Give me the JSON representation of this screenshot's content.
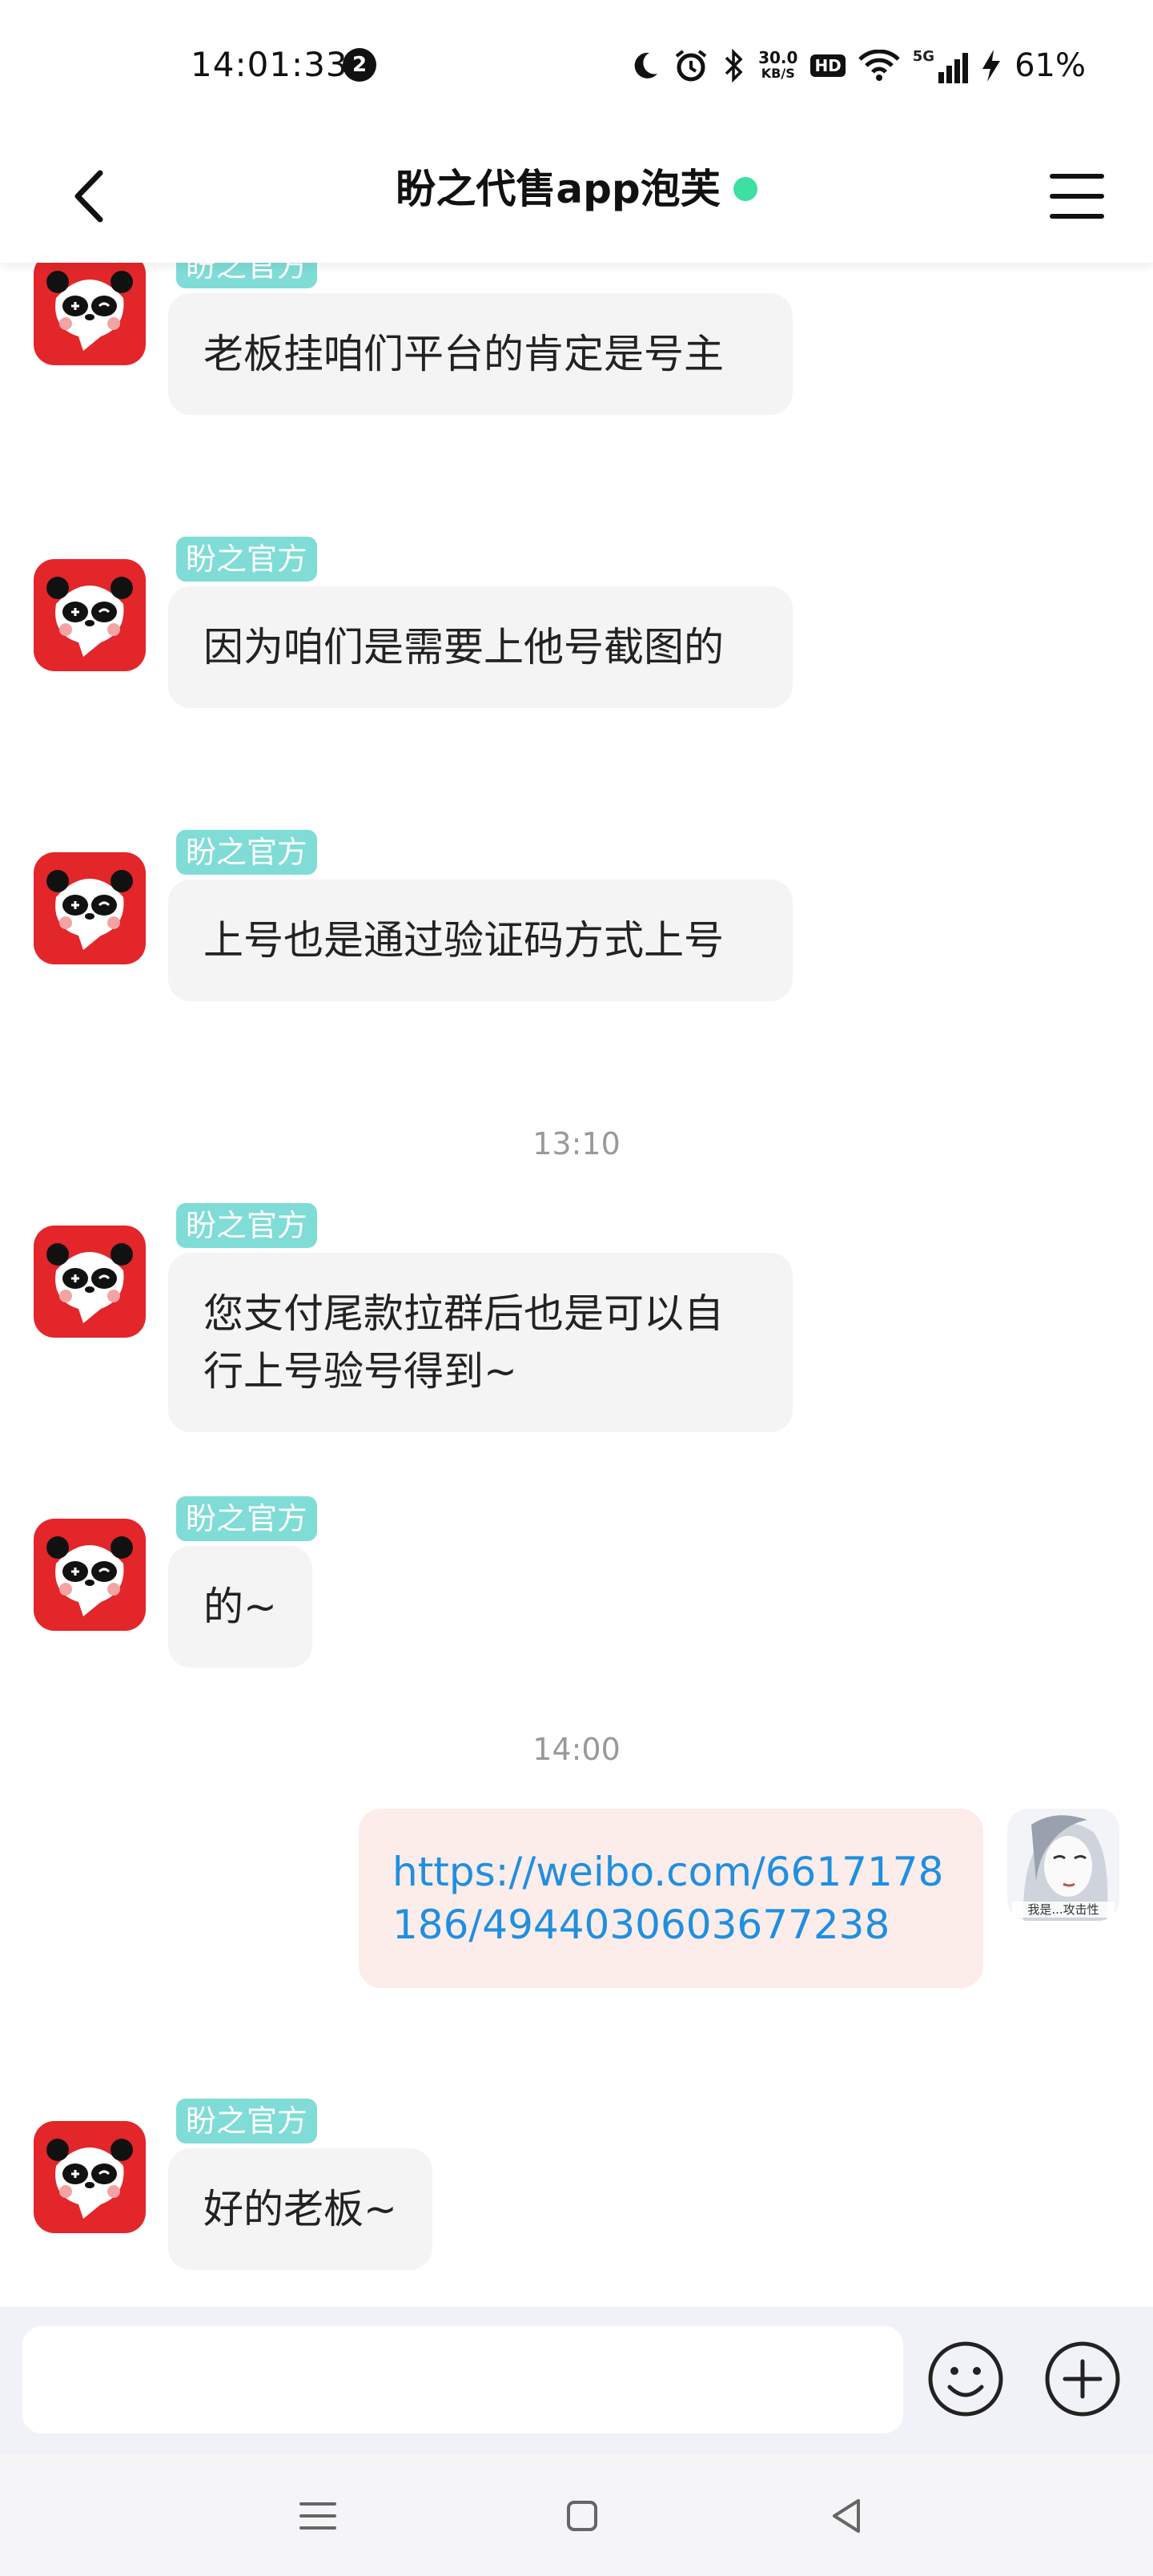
{
  "status_bar": {
    "time": "14:01:33",
    "notification_count": "2",
    "net_speed_value": "30.0",
    "net_speed_unit": "KB/S",
    "hd_label": "HD",
    "network_label": "5G",
    "battery": "61%"
  },
  "header": {
    "title": "盼之代售app泡芙"
  },
  "messages": [
    {
      "sender": "盼之官方",
      "text": "老板挂咱们平台的肯定是号主"
    },
    {
      "sender": "盼之官方",
      "text": "因为咱们是需要上他号截图的"
    },
    {
      "sender": "盼之官方",
      "text": "上号也是通过验证码方式上号"
    },
    {
      "time": "13:10"
    },
    {
      "sender": "盼之官方",
      "text": "您支付尾款拉群后也是可以自行上号验号得到~"
    },
    {
      "sender": "盼之官方",
      "text": "的~"
    },
    {
      "time": "14:00"
    },
    {
      "outgoing": true,
      "text": "https://weibo.com/6617178186/4944030603677238",
      "avatar_caption": "我是...攻击性"
    },
    {
      "sender": "盼之官方",
      "text": "好的老板~"
    }
  ],
  "input": {
    "placeholder": ""
  },
  "colors": {
    "accent_avatar": "#e3262a",
    "sender_tag": "#7fdcd6",
    "online": "#3ee0a2",
    "link": "#1f8fe0"
  }
}
